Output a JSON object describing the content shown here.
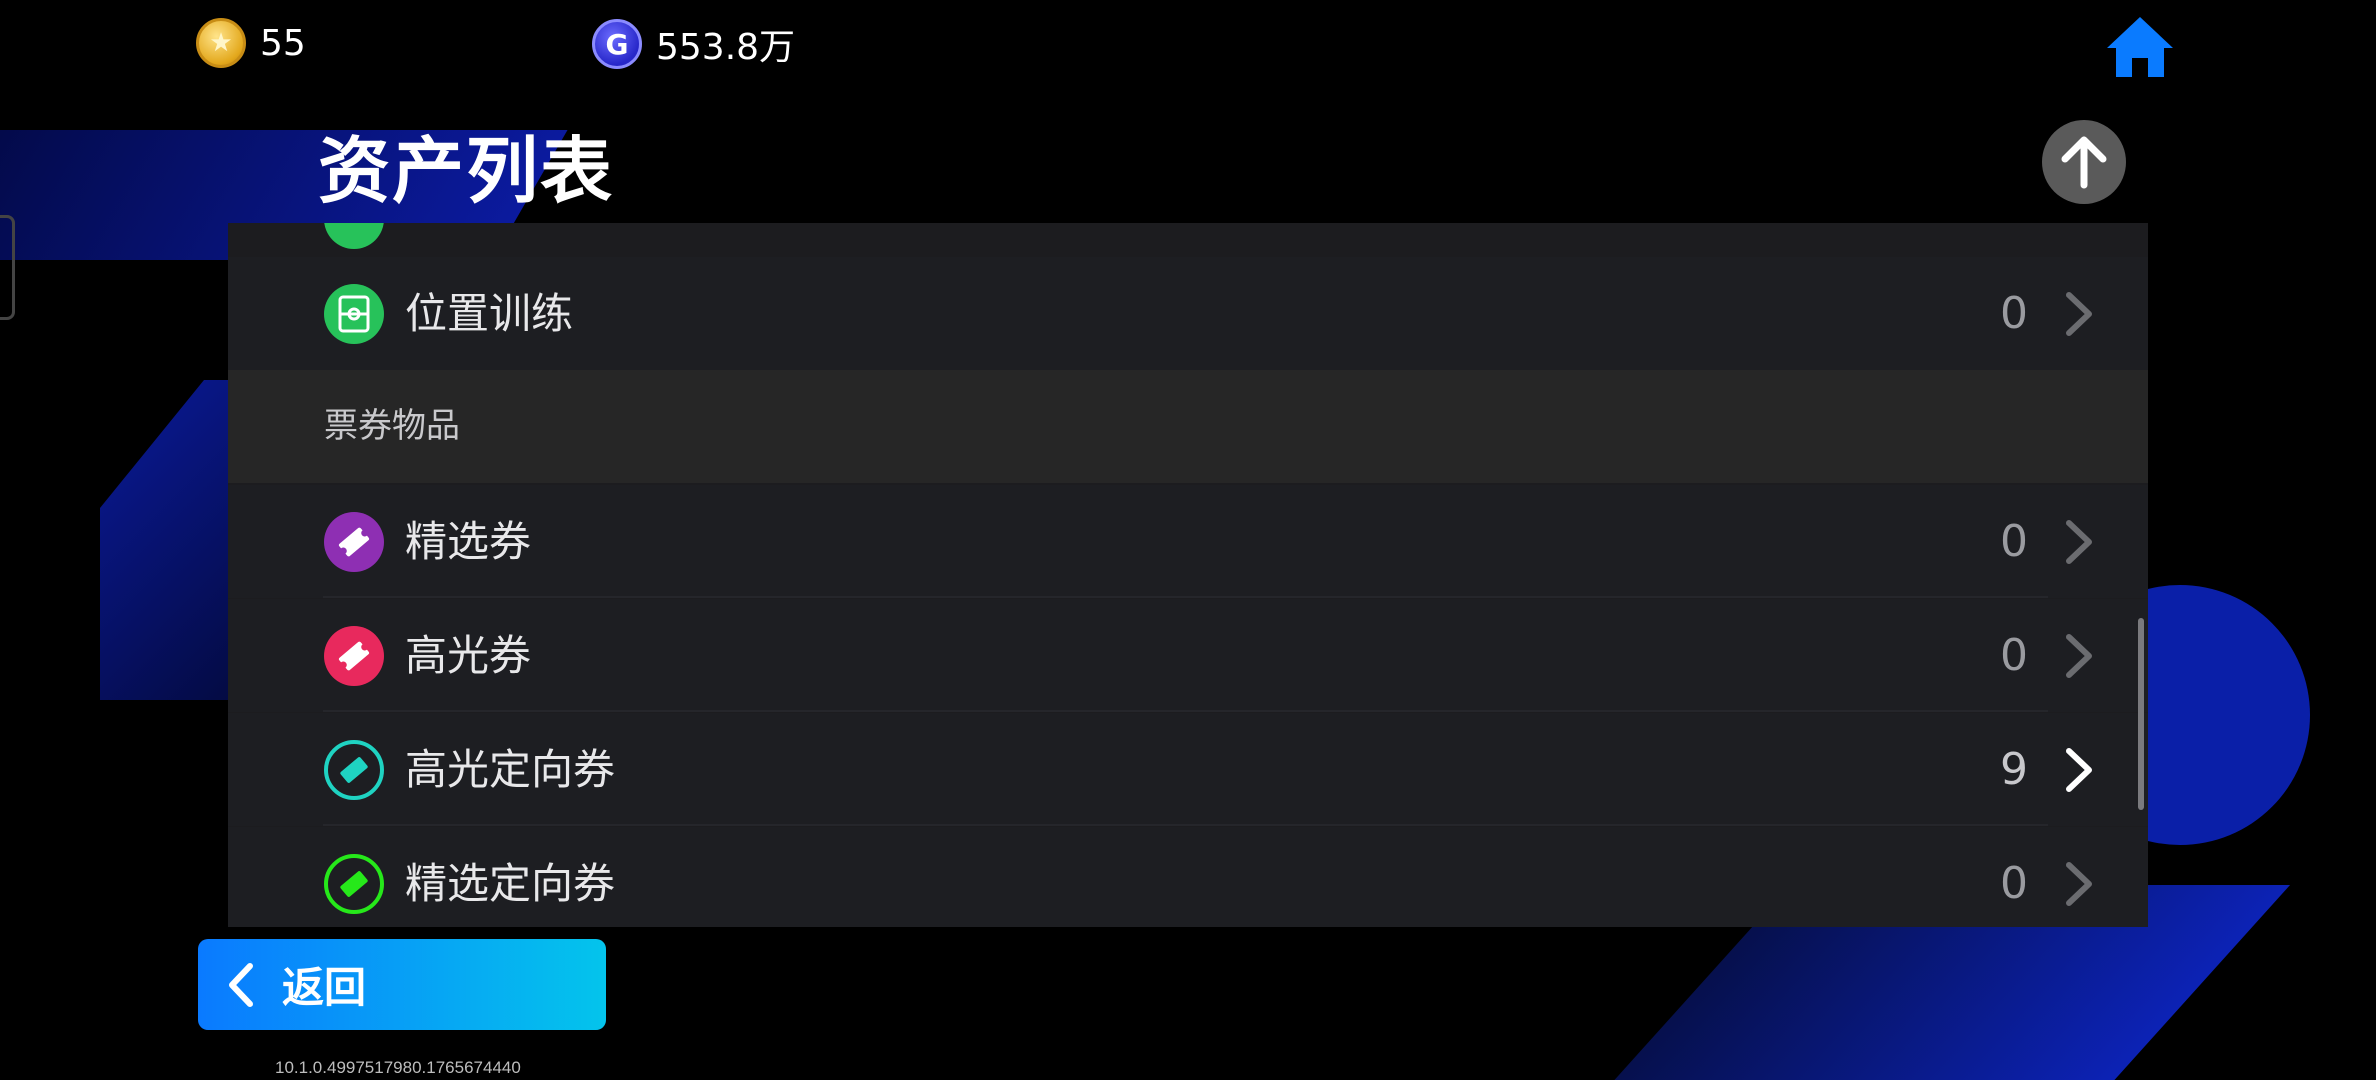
{
  "hud": {
    "coins": {
      "icon": "star-coin-icon",
      "value": "55"
    },
    "g_currency": {
      "icon": "g-coin-icon",
      "value": "553.8万",
      "symbol": "G"
    }
  },
  "header": {
    "title": "资产列表",
    "home_icon": "home-icon",
    "scroll_top_icon": "arrow-up-icon"
  },
  "list": {
    "rows_top": [
      {
        "label": "位置训练",
        "value": "0",
        "icon": "pitch-icon",
        "color": "#27c25a"
      }
    ],
    "section": {
      "label": "票券物品"
    },
    "rows": [
      {
        "label": "精选券",
        "value": "0",
        "icon": "ticket-purple-icon",
        "color": "#8e2fb3"
      },
      {
        "label": "高光券",
        "value": "0",
        "icon": "ticket-red-icon",
        "color": "#e8295d"
      },
      {
        "label": "高光定向券",
        "value": "9",
        "icon": "ticket-target-cyan-icon",
        "color": "#1fd3c2"
      },
      {
        "label": "精选定向券",
        "value": "0",
        "icon": "ticket-target-green-icon",
        "color": "#26e81a"
      }
    ]
  },
  "footer": {
    "back_label": "返回",
    "version": "10.1.0.4997517980.1765674440"
  }
}
